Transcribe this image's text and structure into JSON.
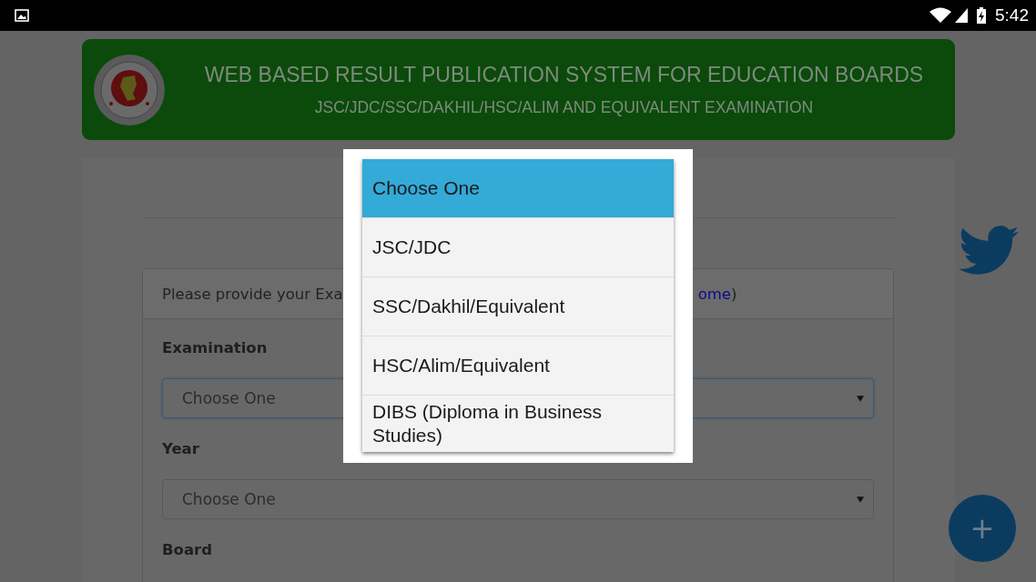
{
  "status_bar": {
    "time": "5:42"
  },
  "header": {
    "title": "WEB BASED RESULT PUBLICATION SYSTEM FOR EDUCATION BOARDS",
    "subtitle": "JSC/JDC/SSC/DAKHIL/HSC/ALIM AND EQUIVALENT EXAMINATION"
  },
  "panel": {
    "heading": "Please provide your Exa",
    "link": "ome",
    "heading_end": ")"
  },
  "fields": [
    {
      "label": "Examination",
      "value": "Choose One",
      "focused": true
    },
    {
      "label": "Year",
      "value": "Choose One",
      "focused": false
    },
    {
      "label": "Board"
    }
  ],
  "dropdown": {
    "options": [
      {
        "label": "Choose One",
        "selected": true
      },
      {
        "label": "JSC/JDC",
        "selected": false
      },
      {
        "label": "SSC/Dakhil/Equivalent",
        "selected": false
      },
      {
        "label": "HSC/Alim/Equivalent",
        "selected": false
      },
      {
        "label": "DIBS (Diploma in Business Studies)",
        "selected": false
      }
    ]
  },
  "fab": {
    "label": "+"
  }
}
